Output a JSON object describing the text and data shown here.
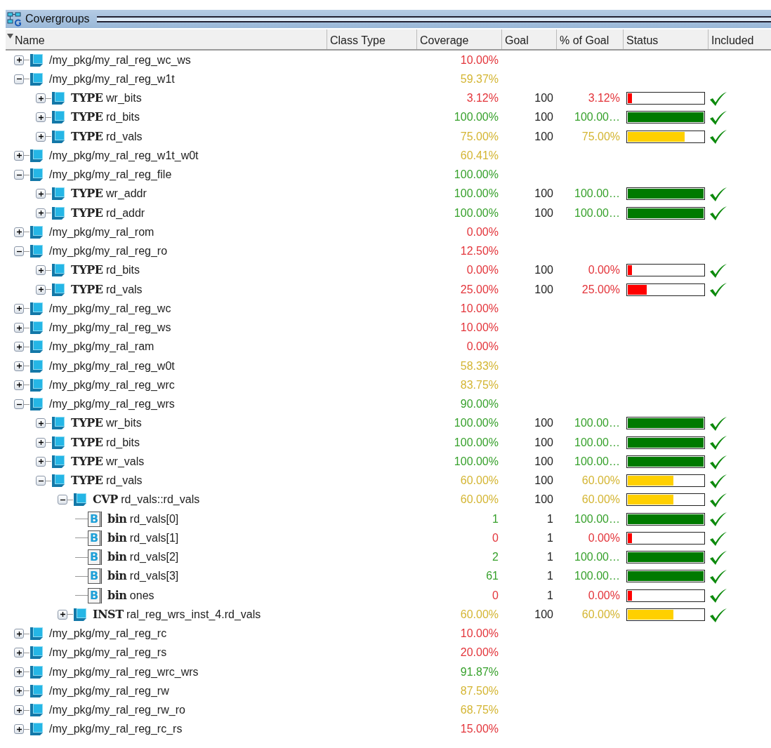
{
  "panel": {
    "title": "Covergroups"
  },
  "columns": [
    "Name",
    "Class Type",
    "Coverage",
    "Goal",
    "% of Goal",
    "Status",
    "Included"
  ],
  "rows": [
    {
      "kind": "group",
      "label": "/my_pkg/my_ral_reg_wc_ws",
      "expanded": false,
      "coverage": "10.00%",
      "color": "#e3343a"
    },
    {
      "kind": "group",
      "label": "/my_pkg/my_ral_reg_w1t",
      "expanded": true,
      "coverage": "59.37%",
      "color": "#d4b532",
      "children": [
        {
          "kind": "group",
          "label": "**TYPE** wr_bits",
          "expanded": false,
          "coverage": "3.12%",
          "color": "#e3343a",
          "goal": "100",
          "pct_of_goal": "3.12%",
          "level": 0.0312,
          "included": true
        },
        {
          "kind": "group",
          "label": "**TYPE** rd_bits",
          "expanded": false,
          "coverage": "100.00%",
          "color": "#37a12c",
          "goal": "100",
          "pct_of_goal": "100.00…",
          "level": 1,
          "included": true
        },
        {
          "kind": "group",
          "label": "**TYPE** rd_vals",
          "expanded": false,
          "coverage": "75.00%",
          "color": "#d4b532",
          "goal": "100",
          "pct_of_goal": "75.00%",
          "level": 0.75,
          "included": true
        }
      ]
    },
    {
      "kind": "group",
      "label": "/my_pkg/my_ral_reg_w1t_w0t",
      "expanded": false,
      "coverage": "60.41%",
      "color": "#d4b532"
    },
    {
      "kind": "group",
      "label": "/my_pkg/my_ral_reg_file",
      "expanded": true,
      "coverage": "100.00%",
      "color": "#37a12c",
      "children": [
        {
          "kind": "group",
          "label": "**TYPE** wr_addr",
          "expanded": false,
          "coverage": "100.00%",
          "color": "#37a12c",
          "goal": "100",
          "pct_of_goal": "100.00…",
          "level": 1,
          "included": true
        },
        {
          "kind": "group",
          "label": "**TYPE** rd_addr",
          "expanded": false,
          "coverage": "100.00%",
          "color": "#37a12c",
          "goal": "100",
          "pct_of_goal": "100.00…",
          "level": 1,
          "included": true
        }
      ]
    },
    {
      "kind": "group",
      "label": "/my_pkg/my_ral_rom",
      "expanded": false,
      "coverage": "0.00%",
      "color": "#e3343a"
    },
    {
      "kind": "group",
      "label": "/my_pkg/my_ral_reg_ro",
      "expanded": true,
      "coverage": "12.50%",
      "color": "#e3343a",
      "children": [
        {
          "kind": "group",
          "label": "**TYPE** rd_bits",
          "expanded": false,
          "coverage": "0.00%",
          "color": "#e3343a",
          "goal": "100",
          "pct_of_goal": "0.00%",
          "level": 0,
          "included": true
        },
        {
          "kind": "group",
          "label": "**TYPE** rd_vals",
          "expanded": false,
          "coverage": "25.00%",
          "color": "#e3343a",
          "goal": "100",
          "pct_of_goal": "25.00%",
          "level": 0.25,
          "included": true
        }
      ]
    },
    {
      "kind": "group",
      "label": "/my_pkg/my_ral_reg_wc",
      "expanded": false,
      "coverage": "10.00%",
      "color": "#e3343a"
    },
    {
      "kind": "group",
      "label": "/my_pkg/my_ral_reg_ws",
      "expanded": false,
      "coverage": "10.00%",
      "color": "#e3343a"
    },
    {
      "kind": "group",
      "label": "/my_pkg/my_ral_ram",
      "expanded": false,
      "coverage": "0.00%",
      "color": "#e3343a"
    },
    {
      "kind": "group",
      "label": "/my_pkg/my_ral_reg_w0t",
      "expanded": false,
      "coverage": "58.33%",
      "color": "#d4b532"
    },
    {
      "kind": "group",
      "label": "/my_pkg/my_ral_reg_wrc",
      "expanded": false,
      "coverage": "83.75%",
      "color": "#d4b532"
    },
    {
      "kind": "group",
      "label": "/my_pkg/my_ral_reg_wrs",
      "expanded": true,
      "coverage": "90.00%",
      "color": "#37a12c",
      "children": [
        {
          "kind": "group",
          "label": "**TYPE** wr_bits",
          "expanded": false,
          "coverage": "100.00%",
          "color": "#37a12c",
          "goal": "100",
          "pct_of_goal": "100.00…",
          "level": 1,
          "included": true
        },
        {
          "kind": "group",
          "label": "**TYPE** rd_bits",
          "expanded": false,
          "coverage": "100.00%",
          "color": "#37a12c",
          "goal": "100",
          "pct_of_goal": "100.00…",
          "level": 1,
          "included": true
        },
        {
          "kind": "group",
          "label": "**TYPE** wr_vals",
          "expanded": false,
          "coverage": "100.00%",
          "color": "#37a12c",
          "goal": "100",
          "pct_of_goal": "100.00…",
          "level": 1,
          "included": true
        },
        {
          "kind": "group",
          "label": "**TYPE** rd_vals",
          "expanded": true,
          "coverage": "60.00%",
          "color": "#d4b532",
          "goal": "100",
          "pct_of_goal": "60.00%",
          "level": 0.6,
          "included": true,
          "children": [
            {
              "kind": "group",
              "label": "**CVP** rd_vals::rd_vals",
              "expanded": true,
              "coverage": "60.00%",
              "color": "#d4b532",
              "goal": "100",
              "pct_of_goal": "60.00%",
              "level": 0.6,
              "included": true,
              "children": [
                {
                  "kind": "bin",
                  "icon_letter": "B",
                  "label": "**bin** rd_vals[0]",
                  "coverage": "1",
                  "goal": "1",
                  "pct_of_goal": "100.00…",
                  "color": "#37a12c",
                  "level": 1,
                  "included": true
                },
                {
                  "kind": "bin",
                  "icon_letter": "B",
                  "label": "**bin** rd_vals[1]",
                  "coverage": "0",
                  "goal": "1",
                  "pct_of_goal": "0.00%",
                  "color": "#e3343a",
                  "level": 0,
                  "included": true
                },
                {
                  "kind": "bin",
                  "icon_letter": "B",
                  "label": "**bin** rd_vals[2]",
                  "coverage": "2",
                  "goal": "1",
                  "pct_of_goal": "100.00…",
                  "color": "#37a12c",
                  "level": 1,
                  "included": true
                },
                {
                  "kind": "bin",
                  "icon_letter": "B",
                  "label": "**bin** rd_vals[3]",
                  "coverage": "61",
                  "goal": "1",
                  "pct_of_goal": "100.00…",
                  "color": "#37a12c",
                  "level": 1,
                  "included": true
                },
                {
                  "kind": "bin",
                  "icon_letter": "B",
                  "label": "**bin** ones",
                  "coverage": "0",
                  "goal": "1",
                  "pct_of_goal": "0.00%",
                  "color": "#e3343a",
                  "level": 0,
                  "included": true
                }
              ]
            },
            {
              "kind": "group",
              "label": "**INST** ral_reg_wrs_inst_4.rd_vals",
              "expanded": false,
              "coverage": "60.00%",
              "color": "#d4b532",
              "goal": "100",
              "pct_of_goal": "60.00%",
              "level": 0.6,
              "included": true
            }
          ]
        }
      ]
    },
    {
      "kind": "group",
      "label": "/my_pkg/my_ral_reg_rc",
      "expanded": false,
      "coverage": "10.00%",
      "color": "#e3343a"
    },
    {
      "kind": "group",
      "label": "/my_pkg/my_ral_reg_rs",
      "expanded": false,
      "coverage": "20.00%",
      "color": "#e3343a"
    },
    {
      "kind": "group",
      "label": "/my_pkg/my_ral_reg_wrc_wrs",
      "expanded": false,
      "coverage": "91.87%",
      "color": "#37a12c"
    },
    {
      "kind": "group",
      "label": "/my_pkg/my_ral_reg_rw",
      "expanded": false,
      "coverage": "87.50%",
      "color": "#d4b532"
    },
    {
      "kind": "group",
      "label": "/my_pkg/my_ral_reg_rw_ro",
      "expanded": false,
      "coverage": "68.75%",
      "color": "#d4b532"
    },
    {
      "kind": "group",
      "label": "/my_pkg/my_ral_reg_rc_rs",
      "expanded": false,
      "coverage": "15.00%",
      "color": "#e3343a"
    }
  ]
}
